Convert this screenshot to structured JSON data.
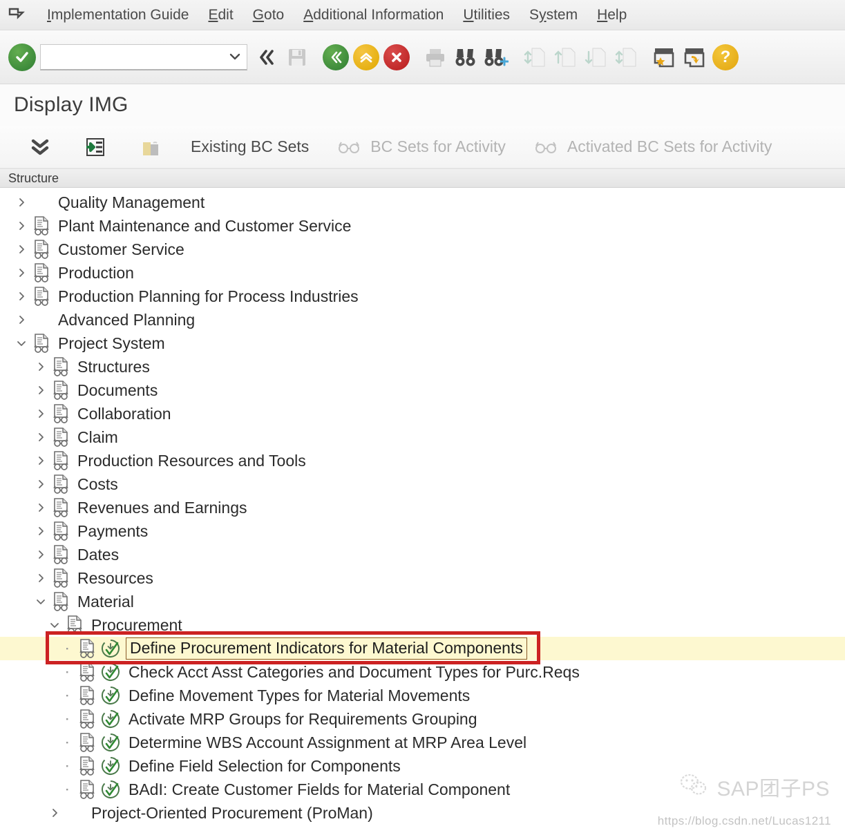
{
  "menubar": {
    "system_icon": "system-menu-icon",
    "items": [
      {
        "label": "Implementation Guide",
        "accel": "I"
      },
      {
        "label": "Edit",
        "accel": "E"
      },
      {
        "label": "Goto",
        "accel": "G"
      },
      {
        "label": "Additional Information",
        "accel": "A"
      },
      {
        "label": "Utilities",
        "accel": "U"
      },
      {
        "label": "System",
        "accel": "y"
      },
      {
        "label": "Help",
        "accel": "H"
      }
    ]
  },
  "toolbar": {
    "enter_icon": "green-check-enter-icon",
    "command_field": {
      "value": "",
      "placeholder": ""
    },
    "command_dropdown_icon": "chevron-down-icon",
    "collapse_icon": "double-chevron-left-icon",
    "save_icon": "save-disk-icon",
    "back_icon": "back-green-icon",
    "exit_icon": "exit-yellow-up-icon",
    "cancel_icon": "cancel-red-x-icon",
    "print_icon": "print-icon",
    "find_icon": "find-binoculars-icon",
    "find_next_icon": "find-next-binoculars-icon",
    "first_page_icon": "first-page-icon",
    "prev_page_icon": "previous-page-icon",
    "next_page_icon": "next-page-icon",
    "last_page_icon": "last-page-icon",
    "create_session_icon": "create-session-star-icon",
    "shortcut_icon": "create-shortcut-icon",
    "help_icon": "help-question-icon"
  },
  "title": "Display IMG",
  "apptoolbar": {
    "buttons": [
      {
        "label": "",
        "icon": "expand-all-chevrons-icon",
        "dim": false,
        "icon_only": true
      },
      {
        "label": "",
        "icon": "expand-node-icon",
        "dim": false,
        "icon_only": true
      },
      {
        "label": "",
        "icon": "release-notes-icon",
        "dim": true,
        "icon_only": true
      },
      {
        "label": "Existing BC Sets",
        "icon": "",
        "dim": false,
        "icon_only": false
      },
      {
        "label": "BC Sets for Activity",
        "icon": "glasses-icon",
        "dim": true,
        "icon_only": false
      },
      {
        "label": "Activated BC Sets for Activity",
        "icon": "glasses-icon",
        "dim": true,
        "icon_only": false
      }
    ]
  },
  "structure": {
    "header": "Structure",
    "rows": [
      {
        "label": "Quality Management",
        "indent": 0,
        "twisty": "collapsed",
        "node_icon": false,
        "activity_icon": false,
        "selected": false
      },
      {
        "label": "Plant Maintenance and Customer Service",
        "indent": 0,
        "twisty": "collapsed",
        "node_icon": true,
        "activity_icon": false,
        "selected": false
      },
      {
        "label": "Customer Service",
        "indent": 0,
        "twisty": "collapsed",
        "node_icon": true,
        "activity_icon": false,
        "selected": false
      },
      {
        "label": "Production",
        "indent": 0,
        "twisty": "collapsed",
        "node_icon": true,
        "activity_icon": false,
        "selected": false
      },
      {
        "label": "Production Planning for Process Industries",
        "indent": 0,
        "twisty": "collapsed",
        "node_icon": true,
        "activity_icon": false,
        "selected": false
      },
      {
        "label": "Advanced Planning",
        "indent": 0,
        "twisty": "collapsed",
        "node_icon": false,
        "activity_icon": false,
        "selected": false
      },
      {
        "label": "Project System",
        "indent": 0,
        "twisty": "expanded",
        "node_icon": true,
        "activity_icon": false,
        "selected": false
      },
      {
        "label": "Structures",
        "indent": 1,
        "twisty": "collapsed",
        "node_icon": true,
        "activity_icon": false,
        "selected": false
      },
      {
        "label": "Documents",
        "indent": 1,
        "twisty": "collapsed",
        "node_icon": true,
        "activity_icon": false,
        "selected": false
      },
      {
        "label": "Collaboration",
        "indent": 1,
        "twisty": "collapsed",
        "node_icon": true,
        "activity_icon": false,
        "selected": false
      },
      {
        "label": "Claim",
        "indent": 1,
        "twisty": "collapsed",
        "node_icon": true,
        "activity_icon": false,
        "selected": false
      },
      {
        "label": "Production Resources and Tools",
        "indent": 1,
        "twisty": "collapsed",
        "node_icon": true,
        "activity_icon": false,
        "selected": false
      },
      {
        "label": "Costs",
        "indent": 1,
        "twisty": "collapsed",
        "node_icon": true,
        "activity_icon": false,
        "selected": false
      },
      {
        "label": "Revenues and Earnings",
        "indent": 1,
        "twisty": "collapsed",
        "node_icon": true,
        "activity_icon": false,
        "selected": false
      },
      {
        "label": "Payments",
        "indent": 1,
        "twisty": "collapsed",
        "node_icon": true,
        "activity_icon": false,
        "selected": false
      },
      {
        "label": "Dates",
        "indent": 1,
        "twisty": "collapsed",
        "node_icon": true,
        "activity_icon": false,
        "selected": false
      },
      {
        "label": "Resources",
        "indent": 1,
        "twisty": "collapsed",
        "node_icon": true,
        "activity_icon": false,
        "selected": false
      },
      {
        "label": "Material",
        "indent": 1,
        "twisty": "expanded",
        "node_icon": true,
        "activity_icon": false,
        "selected": false
      },
      {
        "label": "Procurement",
        "indent": 2,
        "twisty": "expanded",
        "node_icon": true,
        "activity_icon": false,
        "selected": false
      },
      {
        "label": "Define Procurement Indicators for Material Components",
        "indent": 3,
        "twisty": "leaf",
        "node_icon": true,
        "activity_icon": true,
        "selected": true
      },
      {
        "label": "Check Acct Asst Categories and Document Types for Purc.Reqs",
        "indent": 3,
        "twisty": "leaf",
        "node_icon": true,
        "activity_icon": true,
        "selected": false
      },
      {
        "label": "Define Movement Types for Material Movements",
        "indent": 3,
        "twisty": "leaf",
        "node_icon": true,
        "activity_icon": true,
        "selected": false
      },
      {
        "label": "Activate MRP Groups for Requirements Grouping",
        "indent": 3,
        "twisty": "leaf",
        "node_icon": true,
        "activity_icon": true,
        "selected": false
      },
      {
        "label": "Determine WBS Account Assignment at MRP Area Level",
        "indent": 3,
        "twisty": "leaf",
        "node_icon": true,
        "activity_icon": true,
        "selected": false
      },
      {
        "label": "Define Field Selection for Components",
        "indent": 3,
        "twisty": "leaf",
        "node_icon": true,
        "activity_icon": true,
        "selected": false
      },
      {
        "label": "BAdI: Create Customer Fields for Material Component",
        "indent": 3,
        "twisty": "leaf",
        "node_icon": true,
        "activity_icon": true,
        "selected": false
      },
      {
        "label": "Project-Oriented Procurement (ProMan)",
        "indent": 2,
        "twisty": "collapsed",
        "node_icon": false,
        "activity_icon": false,
        "selected": false
      }
    ]
  },
  "annotation": {
    "highlight_color": "#cc2222",
    "highlight_target": "Define Procurement Indicators for Material Components"
  },
  "watermark": {
    "logo_icon": "wechat-logo-icon",
    "text": "SAP团子PS",
    "url": "https://blog.csdn.net/Lucas1211"
  },
  "colors": {
    "selection_bg": "#fdf8d0",
    "accent_green": "#2e7d32",
    "accent_yellow": "#e0a800",
    "accent_red": "#b71c1c"
  }
}
